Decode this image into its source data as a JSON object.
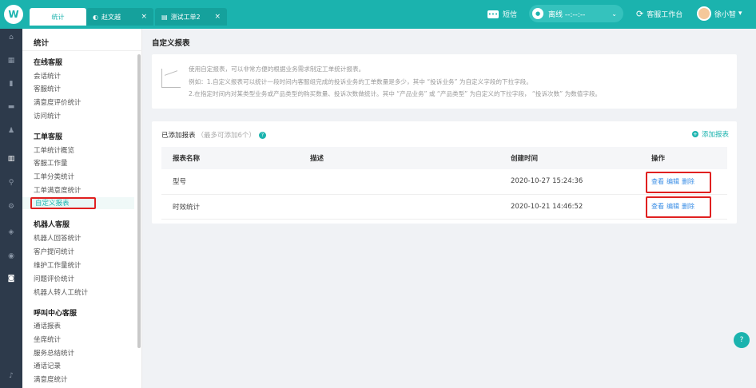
{
  "topbar": {
    "logo": "W",
    "tabs": [
      {
        "label": "统计",
        "icon": ""
      },
      {
        "label": "赵文越",
        "icon": "◐",
        "close": "×"
      },
      {
        "label": "测试工单2",
        "icon": "▤",
        "close": "×"
      }
    ],
    "sms_label": "短信",
    "status_label": "离线 --:--:--",
    "status_caret": "⌄",
    "workbench_label": "客服工作台",
    "user_name": "徐小智",
    "user_caret": "▾"
  },
  "menu": {
    "title": "统计",
    "groups": [
      {
        "label": "在线客服",
        "items": [
          "会话统计",
          "客服统计",
          "满意度评价统计",
          "访问统计"
        ]
      },
      {
        "label": "工单客服",
        "items": [
          "工单统计概览",
          "客服工作量",
          "工单分类统计",
          "工单满意度统计",
          "自定义报表"
        ]
      },
      {
        "label": "机器人客服",
        "items": [
          "机器人回答统计",
          "客户提问统计",
          "维护工作量统计",
          "问题评价统计",
          "机器人转人工统计"
        ]
      },
      {
        "label": "呼叫中心客服",
        "items": [
          "通话报表",
          "坐席统计",
          "服务总结统计",
          "通话记录",
          "满意度统计"
        ]
      }
    ],
    "selected": "自定义报表"
  },
  "main": {
    "page_title": "自定义报表",
    "info_lines": [
      "使用自定报表，可以非常方便的根据业务需求制定工单统计报表。",
      "例如：1.自定义报表可以统计一段时间内客服组完成的投诉业务的工单数量是多少，其中 “投诉业务” 为自定义字段的下拉字段。",
      "2.在指定时间内对某类型业务或产品类型的购买数量、投诉次数做统计。其中 “产品业务” 或 “产品类型” 为自定义的下拉字段， “投诉次数” 为数值字段。"
    ],
    "card_title": "已添加报表",
    "card_hint": "（最多可添加6个）",
    "add_label": "添加报表",
    "table": {
      "headers": [
        "报表名称",
        "描述",
        "创建时间",
        "操作"
      ],
      "rows": [
        {
          "name": "型号",
          "desc": "",
          "created": "2020-10-27 15:24:36",
          "ops": [
            "查看",
            "编辑",
            "删除"
          ]
        },
        {
          "name": "时效统计",
          "desc": "",
          "created": "2020-10-21 14:46:52",
          "ops": [
            "查看",
            "编辑",
            "删除"
          ]
        }
      ]
    }
  },
  "colors": {
    "brand": "#1bb3ae",
    "highlight": "#e02020",
    "link": "#3a8ee6"
  }
}
